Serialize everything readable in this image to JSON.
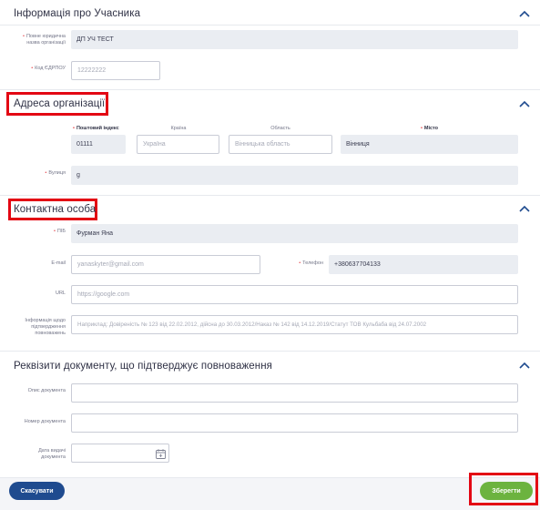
{
  "sections": {
    "participant": {
      "title": "Інформація про Учасника"
    },
    "address": {
      "title": "Адреса організації"
    },
    "contact": {
      "title": "Контактна особа"
    },
    "document": {
      "title": "Реквізити документу, що підтверджує повноваження"
    }
  },
  "participant": {
    "full_name_label": "Повне юридична назва організації",
    "full_name_value": "ДП УЧ ТЕСТ",
    "edrpou_label": "Код ЄДРПОУ",
    "edrpou_value": "12222222"
  },
  "address": {
    "postal_label": "Поштовий індекс",
    "postal_value": "01111",
    "country_label": "Країна",
    "country_value": "Україна",
    "region_label": "Область",
    "region_value": "Вінницька область",
    "city_label": "Місто",
    "city_value": "Вінниця",
    "street_label": "Вулиця",
    "street_value": "g"
  },
  "contact": {
    "name_label": "ПІБ",
    "name_value": "Фурман Яна",
    "email_label": "E-mail",
    "email_value": "yanaskyter@gmail.com",
    "phone_label": "Телефон",
    "phone_value": "+380637704133",
    "url_label": "URL",
    "url_placeholder": "https://google.com",
    "authority_label": "Інформація щодо підтвердження повноважень",
    "authority_placeholder": "Наприклад: Довіреність № 123 від 22.02.2012, дійсна до 30.03.2012/Наказ № 142 від 14.12.2019/Статут ТОВ Кульбаба від 24.07.2002"
  },
  "document": {
    "description_label": "Опис документа",
    "number_label": "Номер документа",
    "date_label": "Дата видачі документа"
  },
  "buttons": {
    "cancel": "Скасувати",
    "save": "Зберегти"
  },
  "colors": {
    "cancel_button": "#1f4b8f",
    "save_button": "#6cb33f",
    "highlight": "#e30613",
    "chevron": "#1f4b8f",
    "required": "#e5484d"
  },
  "icons": {
    "collapse": "chevron-up-icon",
    "calendar": "calendar-icon"
  }
}
